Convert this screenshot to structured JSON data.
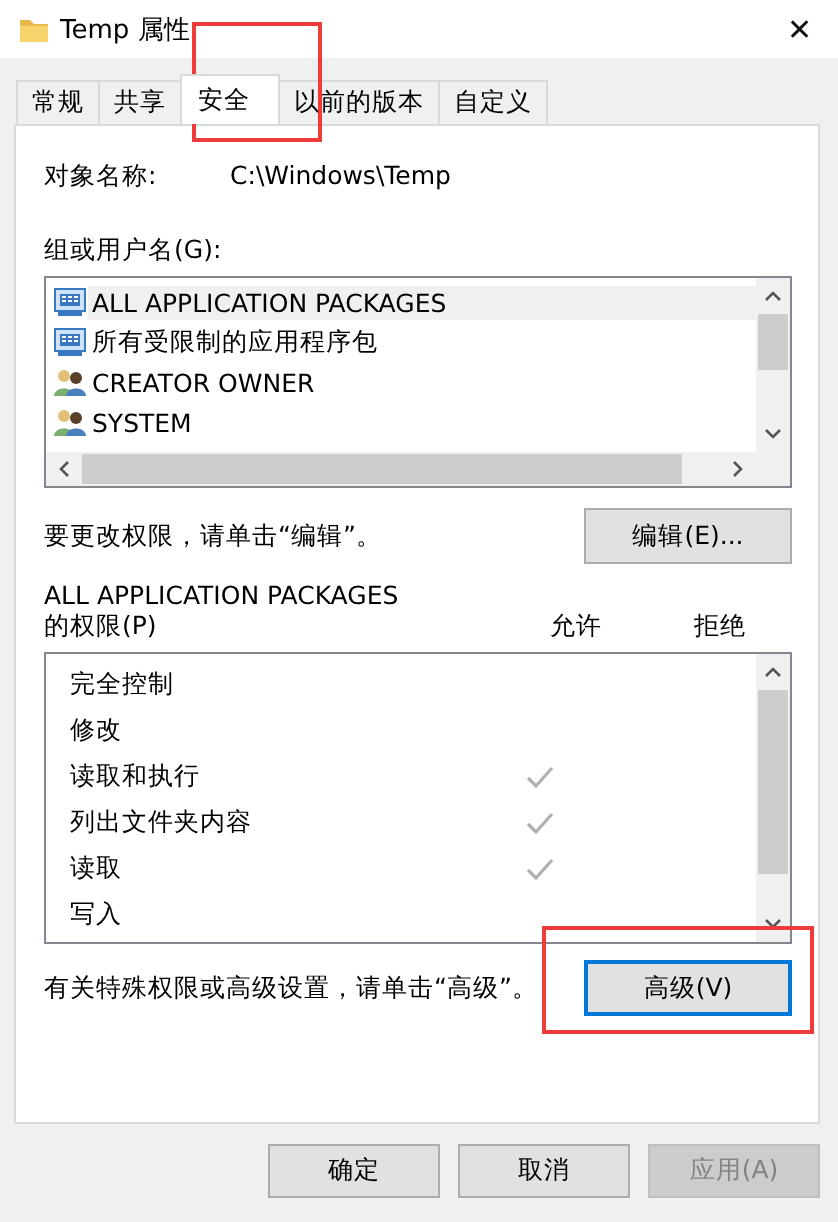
{
  "window": {
    "title": "Temp 属性",
    "close": "✕"
  },
  "tabs": [
    {
      "label": "常规",
      "selected": false
    },
    {
      "label": "共享",
      "selected": false
    },
    {
      "label": "安全",
      "selected": true
    },
    {
      "label": "以前的版本",
      "selected": false
    },
    {
      "label": "自定义",
      "selected": false
    }
  ],
  "object_name": {
    "label": "对象名称:",
    "value": "C:\\Windows\\Temp"
  },
  "groups": {
    "label": "组或用户名(G):",
    "items": [
      {
        "name": "ALL APPLICATION PACKAGES",
        "kind": "package",
        "selected": true
      },
      {
        "name": "所有受限制的应用程序包",
        "kind": "package",
        "selected": false
      },
      {
        "name": "CREATOR OWNER",
        "kind": "users",
        "selected": false
      },
      {
        "name": "SYSTEM",
        "kind": "users",
        "selected": false
      }
    ]
  },
  "edit_hint": "要更改权限，请单击“编辑”。",
  "edit_button": "编辑(E)...",
  "permissions": {
    "title": "ALL APPLICATION PACKAGES",
    "label": "的权限(P)",
    "allow_header": "允许",
    "deny_header": "拒绝",
    "rows": [
      {
        "name": "完全控制",
        "allow": false,
        "deny": false
      },
      {
        "name": "修改",
        "allow": false,
        "deny": false
      },
      {
        "name": "读取和执行",
        "allow": true,
        "deny": false
      },
      {
        "name": "列出文件夹内容",
        "allow": true,
        "deny": false
      },
      {
        "name": "读取",
        "allow": true,
        "deny": false
      },
      {
        "name": "写入",
        "allow": false,
        "deny": false
      }
    ]
  },
  "advanced_hint": "有关特殊权限或高级设置，请单击“高级”。",
  "advanced_button": "高级(V)",
  "buttons": [
    {
      "label": "确定",
      "disabled": false
    },
    {
      "label": "取消",
      "disabled": false
    },
    {
      "label": "应用(A)",
      "disabled": true
    }
  ]
}
